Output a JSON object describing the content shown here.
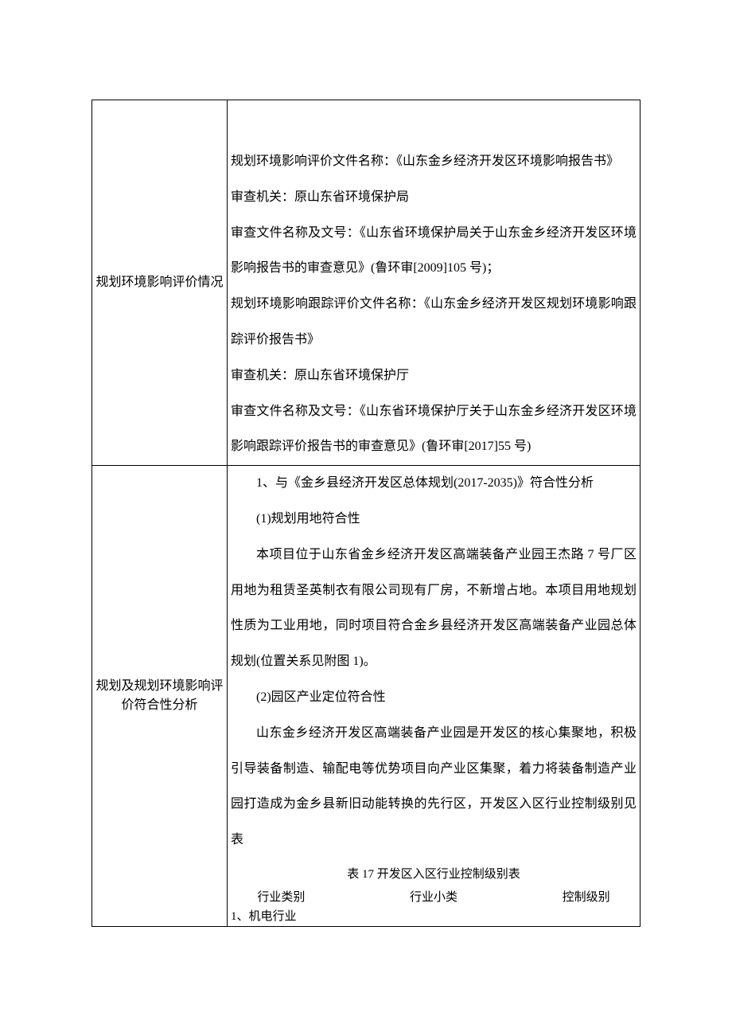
{
  "row1": {
    "label": "规划环境影响评价情况",
    "lines": [
      "规划环境影响评价文件名称：《山东金乡经济开发区环境影响报告书》",
      "审查机关：原山东省环境保护局",
      "审查文件名称及文号：《山东省环境保护局关于山东金乡经济开发区环境影响报告书的审查意见》(鲁环审[2009]105 号)；",
      "规划环境影响跟踪评价文件名称：《山东金乡经济开发区规划环境影响跟踪评价报告书》",
      "审查机关：原山东省环境保护厅",
      "审查文件名称及文号：《山东省环境保护厅关于山东金乡经济开发区环境影响跟踪评价报告书的审查意见》(鲁环审[2017]55 号)"
    ]
  },
  "row2": {
    "label": "规划及规划环境影响评价符合性分析",
    "sec1_title": "1、与《金乡县经济开发区总体规划(2017-2035)》符合性分析",
    "sec1_sub1": "(1)规划用地符合性",
    "sec1_para": "本项目位于山东省金乡经济开发区高端装备产业园王杰路 7 号厂区用地为租赁圣英制衣有限公司现有厂房，不新增占地。本项目用地规划性质为工业用地，同时项目符合金乡县经济开发区高端装备产业园总体规划(位置关系见附图 1)。",
    "sec1_sub2": "(2)园区产业定位符合性",
    "sec2_para": "山东金乡经济开发区高端装备产业园是开发区的核心集聚地，积极引导装备制造、输配电等优势项目向产业区集聚，着力将装备制造产业园打造成为金乡县新旧动能转换的先行区，开发区入区行业控制级别见表",
    "table_caption": "表 17 开发区入区行业控制级别表",
    "table_headers": [
      "行业类别",
      "行业小类",
      "控制级别"
    ],
    "table_first_cell": "1、机电行业"
  }
}
